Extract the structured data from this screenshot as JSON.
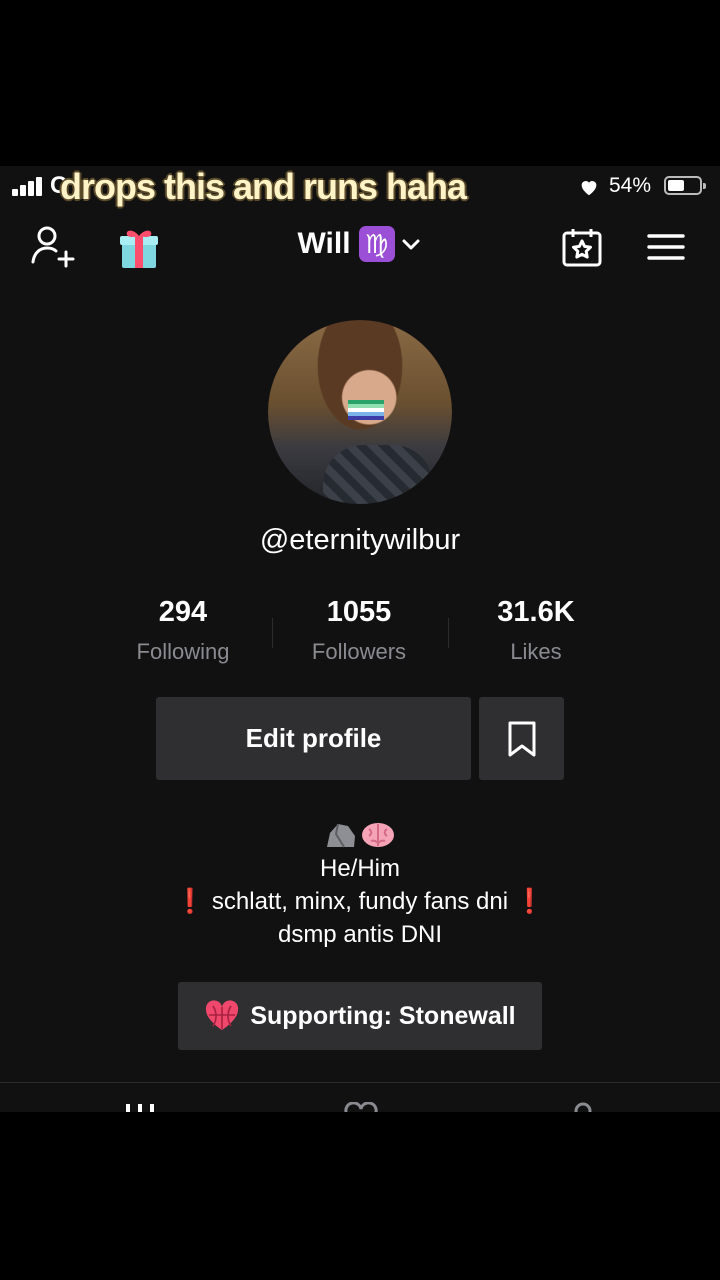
{
  "caption": "drops this and runs haha",
  "status_bar": {
    "carrier_hint": "C",
    "battery": "54%",
    "battery_level": 0.54
  },
  "header": {
    "title": "Will",
    "zodiac": "♍"
  },
  "profile": {
    "username": "@eternitywilbur"
  },
  "stats": [
    {
      "value": "294",
      "label": "Following"
    },
    {
      "value": "1055",
      "label": "Followers"
    },
    {
      "value": "31.6K",
      "label": "Likes"
    }
  ],
  "buttons": {
    "edit_profile": "Edit profile"
  },
  "bio": {
    "pronouns": "He/Him",
    "line1": "schlatt, minx, fundy fans dni",
    "line2": "dsmp antis DNI",
    "exclamation": "❗"
  },
  "support": {
    "label": "Supporting: Stonewall"
  },
  "icons": [
    "add-user-icon",
    "gift-icon",
    "chevron-down-icon",
    "calendar-star-icon",
    "menu-icon",
    "bookmark-icon",
    "globe-heart-icon",
    "rock-icon",
    "brain-icon",
    "heart-icon"
  ],
  "colors": {
    "background": "#111111",
    "button": "#2f2f31",
    "secondary_text": "#8a8b91",
    "accent_red": "#e0243b",
    "zodiac_purple": "#9b4fd6"
  }
}
